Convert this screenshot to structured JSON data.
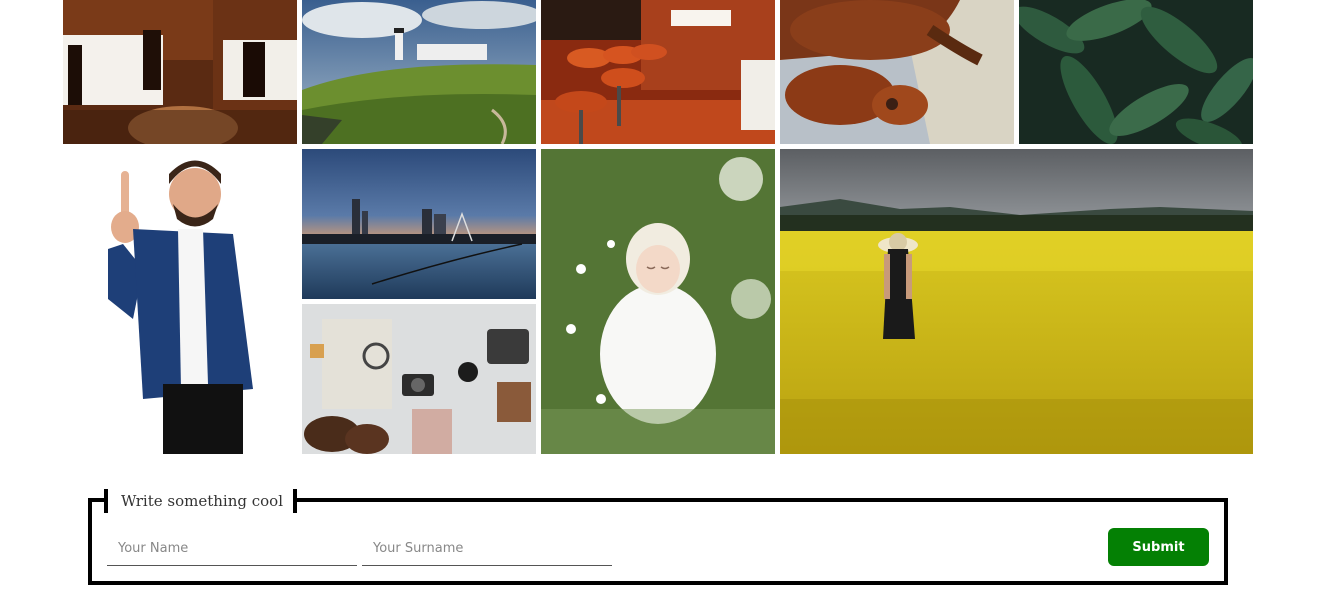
{
  "gallery": {
    "images": [
      {
        "subject": "restaurant-dining-room"
      },
      {
        "subject": "coastal-lighthouse"
      },
      {
        "subject": "bar-stools"
      },
      {
        "subject": "orangutans"
      },
      {
        "subject": "green-leaves"
      },
      {
        "subject": "pointing-businessman"
      },
      {
        "subject": "city-skyline-waterfront"
      },
      {
        "subject": "baby-in-flowers"
      },
      {
        "subject": "woman-in-rapeseed-field"
      },
      {
        "subject": "travel-flatlay"
      }
    ]
  },
  "form": {
    "legend": "Write something cool",
    "name_placeholder": "Your Name",
    "surname_placeholder": "Your Surname",
    "submit_label": "Submit",
    "submit_color": "#048004"
  }
}
